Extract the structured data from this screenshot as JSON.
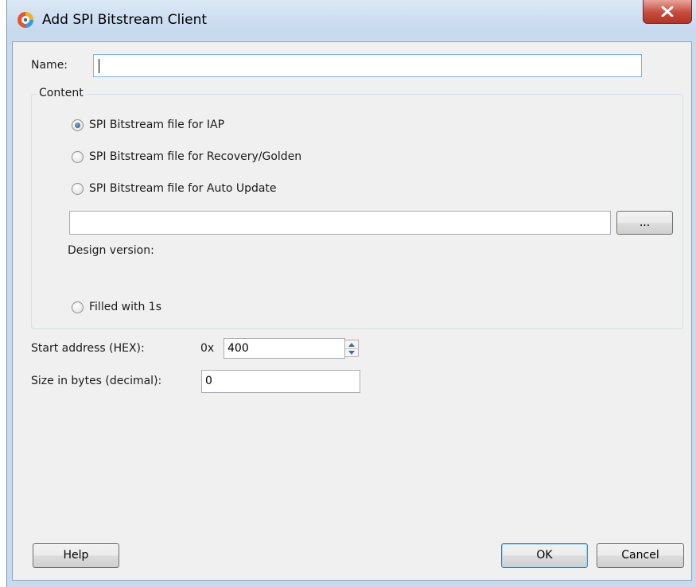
{
  "window": {
    "title": "Add SPI Bitstream Client"
  },
  "name_field": {
    "label": "Name:",
    "value": ""
  },
  "content": {
    "group_title": "Content",
    "options": [
      {
        "label": "SPI Bitstream file for IAP",
        "checked": true
      },
      {
        "label": "SPI Bitstream file for Recovery/Golden",
        "checked": false
      },
      {
        "label": "SPI Bitstream file for Auto Update",
        "checked": false
      }
    ],
    "file_path": "",
    "browse_label": "...",
    "design_version_label": "Design version:",
    "filled_option": {
      "label": "Filled with 1s",
      "checked": false
    }
  },
  "start_address": {
    "label": "Start address (HEX):",
    "prefix": "0x",
    "value": "400"
  },
  "size": {
    "label": "Size in bytes (decimal):",
    "value": "0"
  },
  "buttons": {
    "help": "Help",
    "ok": "OK",
    "cancel": "Cancel"
  },
  "icons": {
    "app": "app-logo-icon",
    "close": "close-x-icon"
  },
  "colors": {
    "titlebar": "#c6d9ee",
    "close_button": "#c64a3b",
    "dialog_bg": "#f0f0f0"
  }
}
